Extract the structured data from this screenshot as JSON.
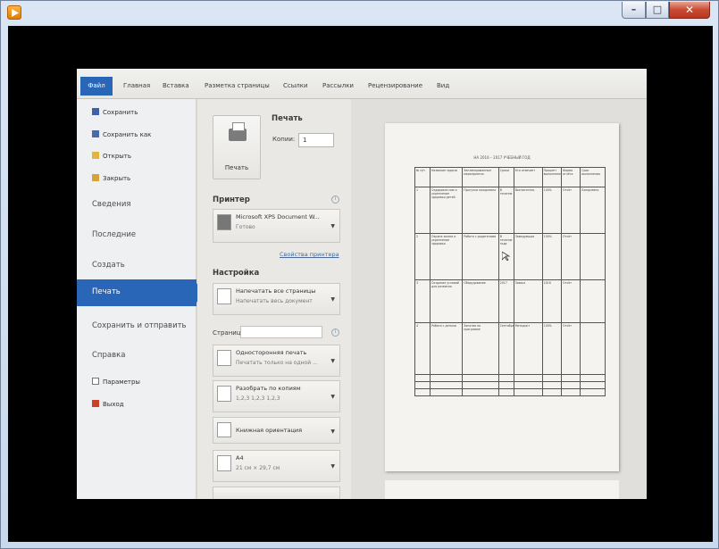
{
  "window": {
    "controls": {
      "minimize": "–",
      "maximize": "□",
      "close": "✕"
    },
    "colors": {
      "close_button": "#c84a32",
      "frame": "#dbe6f4",
      "video_bg": "#000000"
    }
  },
  "word": {
    "ribbon_tabs": [
      "Файл",
      "Главная",
      "Вставка",
      "Разметка страницы",
      "Ссылки",
      "Рассылки",
      "Рецензирование",
      "Вид"
    ],
    "backstage_menu": {
      "commands": [
        {
          "label": "Сохранить",
          "icon": "save-icon"
        },
        {
          "label": "Сохранить как",
          "icon": "save-as-icon"
        },
        {
          "label": "Открыть",
          "icon": "open-folder-icon"
        },
        {
          "label": "Закрыть",
          "icon": "close-doc-icon"
        }
      ],
      "sections": [
        "Сведения",
        "Последние",
        "Создать",
        "Печать",
        "Сохранить и отправить",
        "Справка"
      ],
      "active": "Печать",
      "bottom": [
        {
          "label": "Параметры",
          "icon": "options-icon"
        },
        {
          "label": "Выход",
          "icon": "exit-icon"
        }
      ]
    },
    "print_panel": {
      "heading": "Печать",
      "print_button": "Печать",
      "copies_label": "Копии:",
      "copies_value": "1",
      "printer_heading": "Принтер",
      "printer_name": "Microsoft XPS Document W...",
      "printer_status": "Готово",
      "printer_props_link": "Свойства принтера",
      "settings_heading": "Настройка",
      "print_range": {
        "title": "Напечатать все страницы",
        "subtitle": "Напечатать весь документ"
      },
      "pages_label": "Страницы:",
      "pages_value": "",
      "sides": {
        "title": "Односторонняя печать",
        "subtitle": "Печатать только на одной ..."
      },
      "collate": {
        "title": "Разобрать по копиям",
        "subtitle": "1,2,3    1,2,3    1,2,3"
      },
      "orientation": {
        "title": "Книжная ориентация"
      },
      "paper": {
        "title": "А4",
        "subtitle": "21 см × 29,7 см"
      }
    },
    "preview": {
      "doc_title": "НА 2016 – 2017 УЧЕБНЫЙ ГОД",
      "table_header": [
        "№ п/п",
        "Название задачи",
        "Запланированные мероприятия",
        "Сроки",
        "Кто отвечает",
        "Процент выполнения",
        "Форма отчёта",
        "Срок выполнения"
      ],
      "rows": [
        [
          "1",
          "Оздоровле-ние и укрепление здоровья детей",
          "Прогулки ежедневно",
          "В течение",
          "Воспитатель",
          "100%",
          "Отчёт",
          "Ежедневно"
        ],
        [
          "2",
          "Охрана жизни и укрепление здоровья",
          "Работа с родителями",
          "В течение года",
          "Заведующая",
          "100%",
          "Отчёт",
          ""
        ],
        [
          "3",
          "Создание условий для развития",
          "Оборудование",
          "2017",
          "Завхоз",
          "2016",
          "Отчёт",
          ""
        ],
        [
          "4",
          "Работа с детьми",
          "Занятия по программе",
          "Сентябрь",
          "Методист",
          "100%",
          "Отчёт",
          ""
        ]
      ]
    }
  }
}
